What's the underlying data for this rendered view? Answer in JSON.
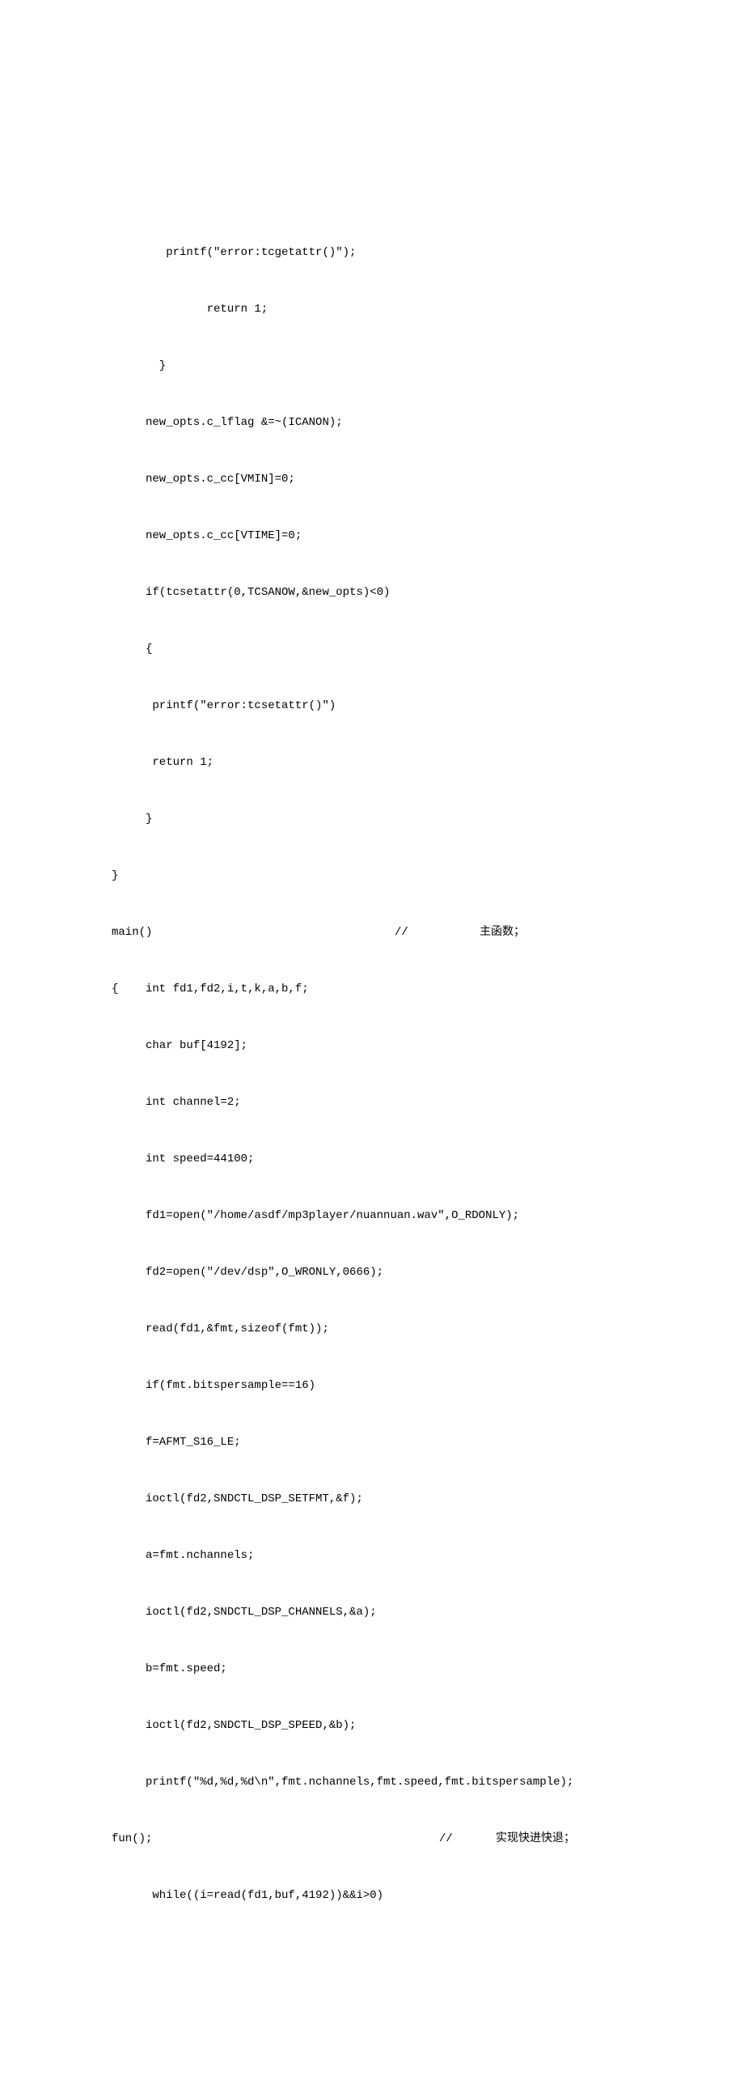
{
  "lines": [
    "        printf(\"error:tcgetattr()\");",
    "              return 1;",
    "       }",
    "     new_opts.c_lflag &=~(ICANON);",
    "     new_opts.c_cc[VMIN]=0;",
    "     new_opts.c_cc[VTIME]=0;",
    "     if(tcsetattr(0,TCSANOW,&new_opts)<0)",
    "     {",
    "      printf(\"error:tcsetattr()\")",
    "      return 1;",
    "     }",
    "}"
  ],
  "mainLine": {
    "code": "main()",
    "slash": "//",
    "comment": "主函数；"
  },
  "mainBody": [
    "{    int fd1,fd2,i,t,k,a,b,f;",
    "     char buf[4192];",
    "     int channel=2;",
    "     int speed=44100;",
    "     fd1=open(\"/home/asdf/mp3player/nuannuan.wav\",O_RDONLY);",
    "     fd2=open(\"/dev/dsp\",O_WRONLY,0666);",
    "     read(fd1,&fmt,sizeof(fmt));",
    "     if(fmt.bitspersample==16)",
    "     f=AFMT_S16_LE;",
    "     ioctl(fd2,SNDCTL_DSP_SETFMT,&f);",
    "     a=fmt.nchannels;",
    "     ioctl(fd2,SNDCTL_DSP_CHANNELS,&a);",
    "     b=fmt.speed;",
    "     ioctl(fd2,SNDCTL_DSP_SPEED,&b);",
    "     printf(\"%d,%d,%d\\n\",fmt.nchannels,fmt.speed,fmt.bitspersample);"
  ],
  "funLine": {
    "code": "fun();",
    "slash": "//",
    "comment": "实现快进快退；"
  },
  "lastLine": "      while((i=read(fd1,buf,4192))&&i>0)"
}
